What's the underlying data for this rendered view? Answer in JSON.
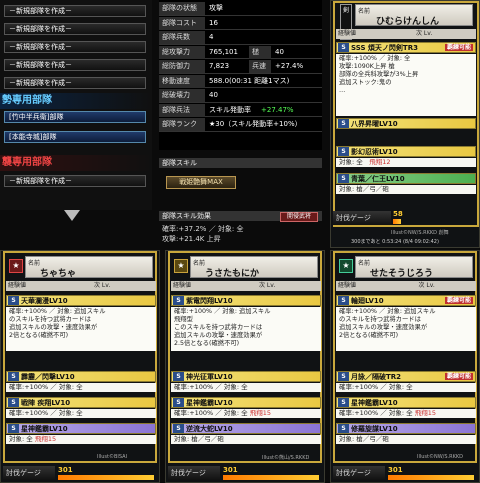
{
  "left": {
    "new_unit_label": "－新規部隊を作成－",
    "section_attack": "勢専用部隊",
    "row1": "[竹中半兵衛]部隊",
    "row2": "[本能寺城]部隊",
    "section_defense": "襲専用部隊"
  },
  "status": {
    "rows": [
      {
        "label": "部隊の状態",
        "value": "攻撃"
      },
      {
        "label": "部隊コスト",
        "value": "16"
      },
      {
        "label": "部隊兵数",
        "value": "4"
      },
      {
        "label": "総攻撃力",
        "value": "765,101",
        "tag": "槌",
        "tagval": "40"
      },
      {
        "label": "総防御力",
        "value": "7,823",
        "tag": "兵速",
        "tagval": "+27.4%"
      },
      {
        "label": "移動速度",
        "value": "588.0(00:31 距離1マス)"
      },
      {
        "label": "総破壊力",
        "value": "40"
      },
      {
        "label": "部隊兵法",
        "value": "スキル発動率",
        "value_green": "+27.47%"
      },
      {
        "label": "部隊ランク",
        "value": "★30（スキル発動率+10%）"
      }
    ],
    "skill_header": "部隊スキル",
    "skill_button": "戦姫艶舞MAX",
    "effect_header": "部隊スキル効果",
    "effect_button": "開侵武将",
    "effect_line1": "確率:+37.2% ／ 対象: 全",
    "effect_line2": "攻撃:+21.4K 上昇"
  },
  "cards": [
    {
      "id": "top",
      "name_label": "名前",
      "name": "ひむらけんしん",
      "rot_badge": "剣",
      "exp_label": "経験値",
      "next_lv": "次 Lv.",
      "sss_title": "SSS 煩天ノ閃剣TR3",
      "sss_badge": "覇練可能",
      "sss_desc": "確率:+100% ／ 対象: 全\n攻撃:1090K上昇 槍\n部隊の全兵科攻撃が3%上昇\n追加ストック:鬼の\n…",
      "skill2": "八界昇曜LV10",
      "skill3": "影幻忍術LV10",
      "skill3_target": "対象: 全",
      "skill3_tag": "飛翔12",
      "skill4": "青葉／仁王LV10",
      "skill4_target": "対象: 槍／弓／砲",
      "footer": "討伐ゲージ",
      "footer_num": "58",
      "credit": "Illust©NW/S.RKKD 創舞",
      "time": "300まであと 0:53:24 (8/4 09:02:42)"
    },
    {
      "id": "c1",
      "name_label": "名前",
      "name": "ちゃちゃ",
      "exp_label": "経験値",
      "next_lv": "次 Lv.",
      "skill1": "天華瀾漫LV10",
      "desc1": "確率:+100% ／ 対象: 追加スキル\nのスキルを持つ武将カードは\n追加スキルの攻撃・速度効果が\n2倍となる(確撚不可)",
      "skill2": "霹靂／閃撃LV10",
      "target2": "確率:+100% ／ 対象: 全",
      "skill3": "戦陣 疾翔LV10",
      "target3": "確率:+100% ／ 対象: 全",
      "skill4": "星神鑑霸LV10",
      "target4": "対象: 全",
      "tag4": "飛翔15",
      "footer": "討伐ゲージ",
      "footer_num": "301",
      "credit": "Illust©BISAI"
    },
    {
      "id": "c2",
      "name_label": "名前",
      "name": "うさたもにか",
      "exp_label": "経験値",
      "next_lv": "次 Lv.",
      "skill1": "紫電閃翔LV10",
      "desc1": "確率:+100% ／ 対象: 追加スキル\n飛翔型\nこのスキルを持つ武将カードは\n追加スキルの攻撃・速度効果が\n2.5倍となる(確撚不可)",
      "skill2": "神光征軍LV10",
      "target2": "確率:+100% ／ 対象: 全",
      "skill3": "星神鑑霸LV10",
      "target3": "確率:+100% ／ 対象: 全",
      "tag3": "飛翔15",
      "skill4": "逆流大蛇LV10",
      "target4": "対象: 槍／弓／砲",
      "footer": "討伐ゲージ",
      "footer_num": "301",
      "credit": "Illust©熊山/S.RKKD"
    },
    {
      "id": "c3",
      "name_label": "名前",
      "name": "せたそうじろう",
      "exp_label": "経験値",
      "next_lv": "次 Lv.",
      "skill1": "輪廻LV10",
      "skill1_badge": "覇練可能",
      "desc1": "確率:+100% ／ 対象: 追加スキル\nのスキルを持つ武将カードは\n追加スキルの攻撃・速度効果が\n2倍となる(確撚不可)",
      "skill2": "月詠／隔破TR2",
      "skill2_badge": "覇練可能",
      "target2": "確率:+100% ／ 対象: 全",
      "skill3": "星神鑑霸LV10",
      "target3": "確率:+100% ／ 対象: 全",
      "tag3": "飛翔15",
      "skill4": "修羅旋謀LV10",
      "target4": "対象: 槍／弓／砲",
      "footer": "討伐ゲージ",
      "footer_num": "301",
      "credit": "Illust©NW/S.RKKD"
    }
  ]
}
